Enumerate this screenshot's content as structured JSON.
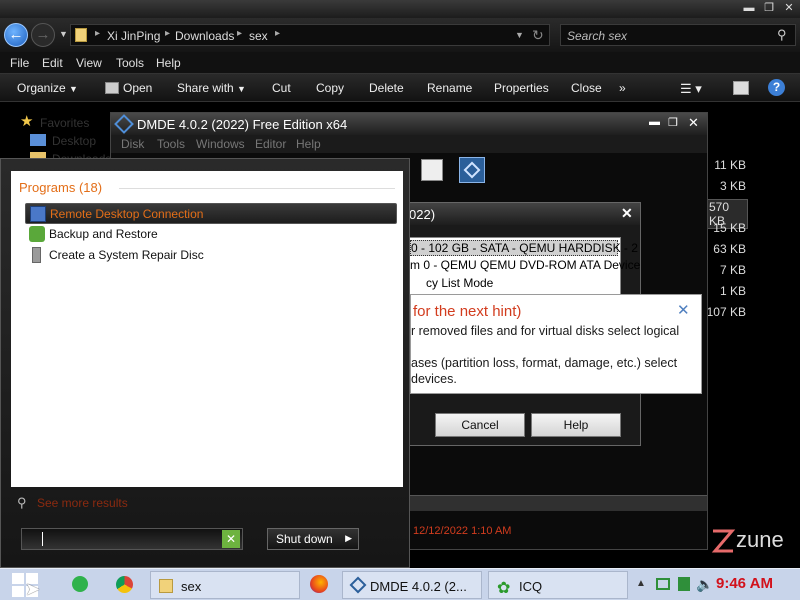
{
  "explorer": {
    "breadcrumb": [
      "Xi JinPing",
      "Downloads",
      "sex"
    ],
    "search_placeholder": "Search sex",
    "menu": [
      "File",
      "Edit",
      "View",
      "Tools",
      "Help"
    ],
    "commands": [
      "Organize",
      "Open",
      "Share with",
      "Cut",
      "Copy",
      "Delete",
      "Rename",
      "Properties",
      "Close",
      "»"
    ],
    "nav_items": [
      "Favorites",
      "Desktop",
      "Downloads"
    ],
    "file_sizes": [
      "11 KB",
      "3 KB",
      "570 KB",
      "15 KB",
      "63 KB",
      "7 KB",
      "1 KB",
      "107 KB"
    ],
    "selected_size_index": 2,
    "zune_text": "zune"
  },
  "dmde": {
    "title": "DMDE 4.0.2 (2022) Free Edition x64",
    "menu": [
      "Disk",
      "Tools",
      "Windows",
      "Editor",
      "Help"
    ],
    "status_time": "12/12/2022 1:10 AM",
    "dialog": {
      "title_fragment": "022)",
      "devices": [
        "0 - 102 GB - SATA - QEMU HARDDISK - 2",
        "m 0 - QEMU QEMU DVD-ROM ATA Device",
        "cy List Mode"
      ],
      "buttons": [
        "Cancel",
        "Help"
      ]
    },
    "hint": {
      "heading": "for the next hint)",
      "lines": [
        "r removed files and for virtual disks select logical",
        "",
        "ases (partition loss, format, damage, etc.) select",
        "devices."
      ]
    }
  },
  "startmenu": {
    "heading": "Programs (18)",
    "programs": [
      "Remote Desktop Connection",
      "Backup and Restore",
      "Create a System Repair Disc"
    ],
    "see_more": "See more results",
    "search_value": "",
    "shutdown": "Shut down"
  },
  "taskbar": {
    "items": [
      "sex",
      "DMDE 4.0.2 (2...",
      "ICQ"
    ],
    "clock": "9:46 AM"
  },
  "colors": {
    "accent_orange": "#e36e18",
    "hint_red": "#d23c1e",
    "clock_red": "#d2111b"
  }
}
